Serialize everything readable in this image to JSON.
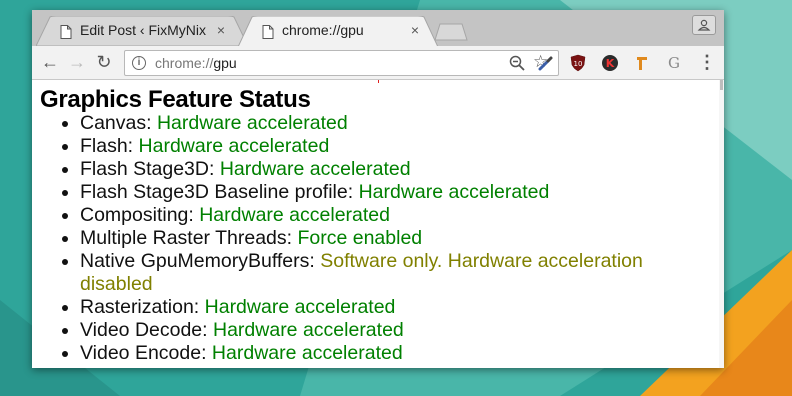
{
  "colors": {
    "status_enabled": "#008000",
    "status_software": "#808000",
    "wallpaper_teal": "#2fa59a",
    "wallpaper_orange": "#f3a21f"
  },
  "tabs": [
    {
      "title": "Edit Post ‹ FixMyNix",
      "icon": "page-icon",
      "close": "×"
    },
    {
      "title": "chrome://gpu",
      "icon": "page-icon",
      "close": "×",
      "active": true
    }
  ],
  "toolbar": {
    "back_icon": "←",
    "forward_icon": "→",
    "reload_icon": "↻",
    "url_scheme": "chrome://",
    "url_host": "gpu",
    "star_icon": "☆",
    "menu_icon": "⋮"
  },
  "extensions": [
    "eyedropper-icon",
    "ublock-icon",
    "k-extension-icon",
    "pin-extension-icon",
    "grammarly-icon"
  ],
  "page": {
    "title": "Graphics Feature Status",
    "features": [
      {
        "name": "Canvas: ",
        "status": "Hardware accelerated",
        "kind": "green"
      },
      {
        "name": "Flash: ",
        "status": "Hardware accelerated",
        "kind": "green"
      },
      {
        "name": "Flash Stage3D: ",
        "status": "Hardware accelerated",
        "kind": "green"
      },
      {
        "name": "Flash Stage3D Baseline profile: ",
        "status": "Hardware accelerated",
        "kind": "green"
      },
      {
        "name": "Compositing: ",
        "status": "Hardware accelerated",
        "kind": "green"
      },
      {
        "name": "Multiple Raster Threads: ",
        "status": "Force enabled",
        "kind": "green"
      },
      {
        "name": "Native GpuMemoryBuffers: ",
        "status": "Software only. Hardware acceleration disabled",
        "kind": "olive"
      },
      {
        "name": "Rasterization: ",
        "status": "Hardware accelerated",
        "kind": "green"
      },
      {
        "name": "Video Decode: ",
        "status": "Hardware accelerated",
        "kind": "green"
      },
      {
        "name": "Video Encode: ",
        "status": "Hardware accelerated",
        "kind": "green"
      }
    ]
  }
}
